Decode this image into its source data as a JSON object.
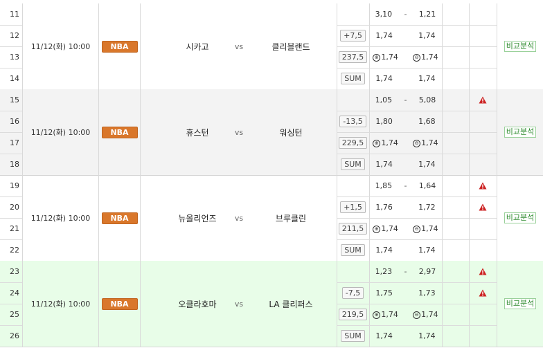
{
  "compare_label": "비교분석",
  "games": [
    {
      "date": "11/12(화) 10:00",
      "league": "NBA",
      "home": "시카고",
      "vs": "vs",
      "away": "클리블랜드",
      "rows": [
        {
          "no": "11",
          "handi": "",
          "left": "3,10",
          "mid": "-",
          "right": "1,21",
          "warn": false
        },
        {
          "no": "12",
          "handi": "+7,5",
          "left": "1,74",
          "mid": "",
          "right": "1,74",
          "warn": false
        },
        {
          "no": "13",
          "handi": "237,5",
          "left": "1,74",
          "mid": "",
          "right": "1,74",
          "warn": false,
          "ou": true
        },
        {
          "no": "14",
          "handi": "SUM",
          "left": "1,74",
          "mid": "",
          "right": "1,74",
          "warn": false
        }
      ]
    },
    {
      "date": "11/12(화) 10:00",
      "league": "NBA",
      "home": "휴스턴",
      "vs": "vs",
      "away": "워싱턴",
      "rows": [
        {
          "no": "15",
          "handi": "",
          "left": "1,05",
          "mid": "-",
          "right": "5,08",
          "warn": true
        },
        {
          "no": "16",
          "handi": "-13,5",
          "left": "1,80",
          "mid": "",
          "right": "1,68",
          "warn": false
        },
        {
          "no": "17",
          "handi": "229,5",
          "left": "1,74",
          "mid": "",
          "right": "1,74",
          "warn": false,
          "ou": true
        },
        {
          "no": "18",
          "handi": "SUM",
          "left": "1,74",
          "mid": "",
          "right": "1,74",
          "warn": false
        }
      ]
    },
    {
      "date": "11/12(화) 10:00",
      "league": "NBA",
      "home": "뉴올리언즈",
      "vs": "vs",
      "away": "브루클린",
      "rows": [
        {
          "no": "19",
          "handi": "",
          "left": "1,85",
          "mid": "-",
          "right": "1,64",
          "warn": true
        },
        {
          "no": "20",
          "handi": "+1,5",
          "left": "1,76",
          "mid": "",
          "right": "1,72",
          "warn": true
        },
        {
          "no": "21",
          "handi": "211,5",
          "left": "1,74",
          "mid": "",
          "right": "1,74",
          "warn": false,
          "ou": true
        },
        {
          "no": "22",
          "handi": "SUM",
          "left": "1,74",
          "mid": "",
          "right": "1,74",
          "warn": false
        }
      ]
    },
    {
      "date": "11/12(화) 10:00",
      "league": "NBA",
      "home": "오클라호마",
      "vs": "vs",
      "away": "LA 클리퍼스",
      "rows": [
        {
          "no": "23",
          "handi": "",
          "left": "1,23",
          "mid": "-",
          "right": "2,97",
          "warn": true
        },
        {
          "no": "24",
          "handi": "-7,5",
          "left": "1,75",
          "mid": "",
          "right": "1,73",
          "warn": true
        },
        {
          "no": "25",
          "handi": "219,5",
          "left": "1,74",
          "mid": "",
          "right": "1,74",
          "warn": false,
          "ou": true
        },
        {
          "no": "26",
          "handi": "SUM",
          "left": "1,74",
          "mid": "",
          "right": "1,74",
          "warn": false
        }
      ]
    }
  ],
  "colors": {
    "league_badge": "#d9772b",
    "highlight_row": "#e8fde8",
    "alt_row": "#f3f3f3",
    "compare_text": "#2e8b2e",
    "warning": "#cc2222"
  },
  "icons": {
    "warning": "warning-icon",
    "over": "over-icon",
    "under": "under-icon"
  }
}
